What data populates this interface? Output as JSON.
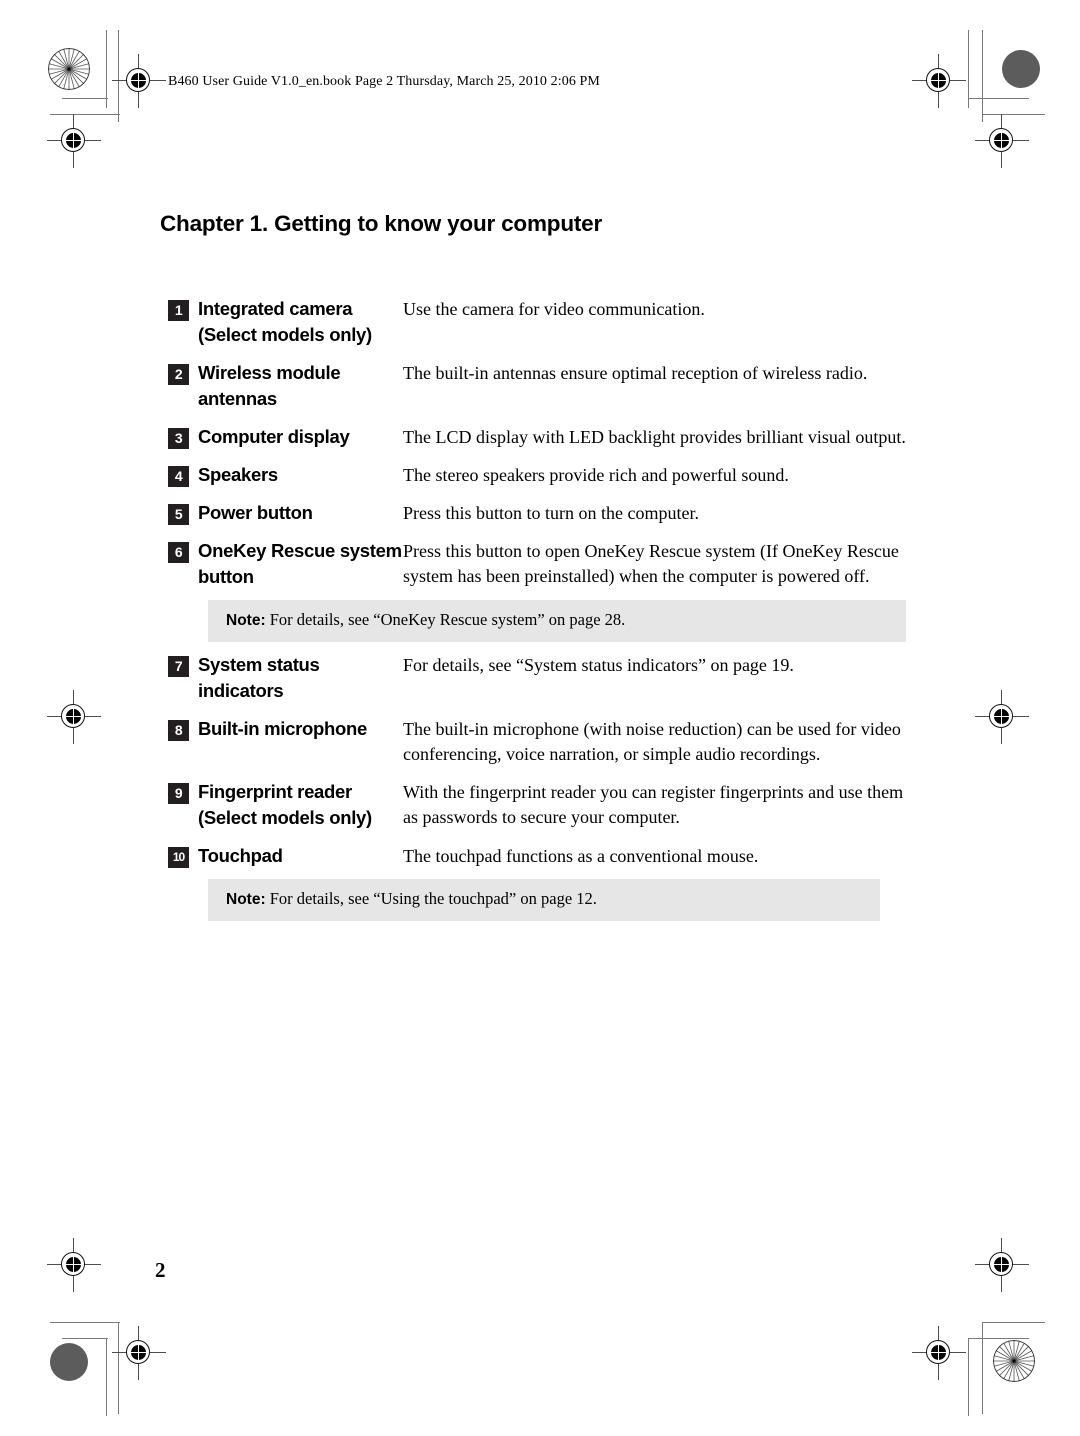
{
  "document": {
    "running_header": "B460 User Guide V1.0_en.book  Page 2  Thursday, March 25, 2010  2:06 PM",
    "chapter_title": "Chapter 1. Getting to know your computer",
    "page_number": "2"
  },
  "table": {
    "rows": [
      {
        "number": "1",
        "label": "Integrated camera (Select models only)",
        "description": "Use the camera for video communication."
      },
      {
        "number": "2",
        "label": "Wireless module antennas",
        "description": "The built-in antennas ensure optimal reception of wireless radio."
      },
      {
        "number": "3",
        "label": "Computer display",
        "description": "The LCD display with LED backlight provides brilliant visual output."
      },
      {
        "number": "4",
        "label": "Speakers",
        "description": "The stereo speakers provide rich and powerful sound."
      },
      {
        "number": "5",
        "label": "Power button",
        "description": "Press this button to turn on the computer."
      },
      {
        "number": "6",
        "label": "OneKey Rescue system button",
        "description": "Press this button to open OneKey Rescue system (If OneKey Rescue system has been preinstalled) when the computer is powered off."
      },
      {
        "number": "7",
        "label": "System status indicators",
        "description": "For details, see “System status indicators” on page 19."
      },
      {
        "number": "8",
        "label": "Built-in microphone",
        "description": "The built-in microphone (with noise reduction) can be used for video conferencing, voice narration, or simple audio recordings."
      },
      {
        "number": "9",
        "label": "Fingerprint reader (Select models only)",
        "description": "With the fingerprint reader you can register fingerprints and use them as passwords to secure your computer."
      },
      {
        "number": "10",
        "label": "Touchpad",
        "description": "The touchpad functions as a conventional mouse."
      }
    ]
  },
  "notes": [
    {
      "keyword": "Note:",
      "text": " For details, see “OneKey Rescue system” on page 28."
    },
    {
      "keyword": "Note:",
      "text": " For details, see “Using the touchpad” on page 12."
    }
  ],
  "colors": {
    "badge_background": "#231f20",
    "badge_text": "#ffffff",
    "note_background": "#e6e6e6",
    "page_background": "#ffffff",
    "registration_mark": "#4d4d4d"
  }
}
